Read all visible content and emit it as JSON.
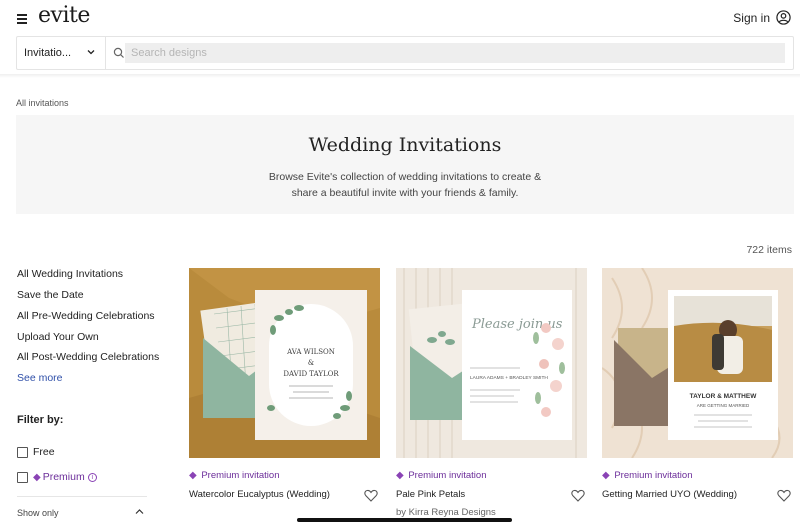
{
  "header": {
    "logo": "evite",
    "sign_in": "Sign in"
  },
  "search": {
    "category": "Invitatio...",
    "placeholder": "Search designs"
  },
  "breadcrumb": "All invitations",
  "hero": {
    "title": "Wedding Invitations",
    "description": "Browse Evite's collection of wedding invitations to create & share a beautiful invite with your friends & family."
  },
  "results": {
    "count": "722 items"
  },
  "sidebar": {
    "items": [
      {
        "label": "All Wedding Invitations"
      },
      {
        "label": "Save the Date"
      },
      {
        "label": "All Pre-Wedding Celebrations"
      },
      {
        "label": "Upload Your Own"
      },
      {
        "label": "All Post-Wedding Celebrations"
      }
    ],
    "see_more": "See more",
    "filter_title": "Filter by:",
    "filters": [
      {
        "label": "Free",
        "checked": false
      },
      {
        "label": "Premium",
        "checked": false
      }
    ],
    "show_only": "Show only"
  },
  "cards": [
    {
      "badge": "Premium invitation",
      "title": "Watercolor Eucalyptus (Wedding)",
      "byline": "",
      "art": {
        "name1": "AVA WILSON",
        "amp": "&",
        "name2": "DAVID TAYLOR"
      }
    },
    {
      "badge": "Premium invitation",
      "title": "Pale Pink Petals",
      "byline": "by Kirra Reyna Designs",
      "art": {
        "script": "Please join us",
        "names": "LAURA ADAMS + BRADLEY SMITH"
      }
    },
    {
      "badge": "Premium invitation",
      "title": "Getting Married UYO (Wedding)",
      "byline": "",
      "art": {
        "names": "TAYLOR & MATTHEW",
        "sub": "ARE GETTING MARRIED"
      }
    }
  ],
  "colors": {
    "premium_purple": "#6c2e9a",
    "link_blue": "#2f4fa8",
    "hero_bg": "#f6f6f6",
    "sage_envelope": "#8fb5a0"
  }
}
